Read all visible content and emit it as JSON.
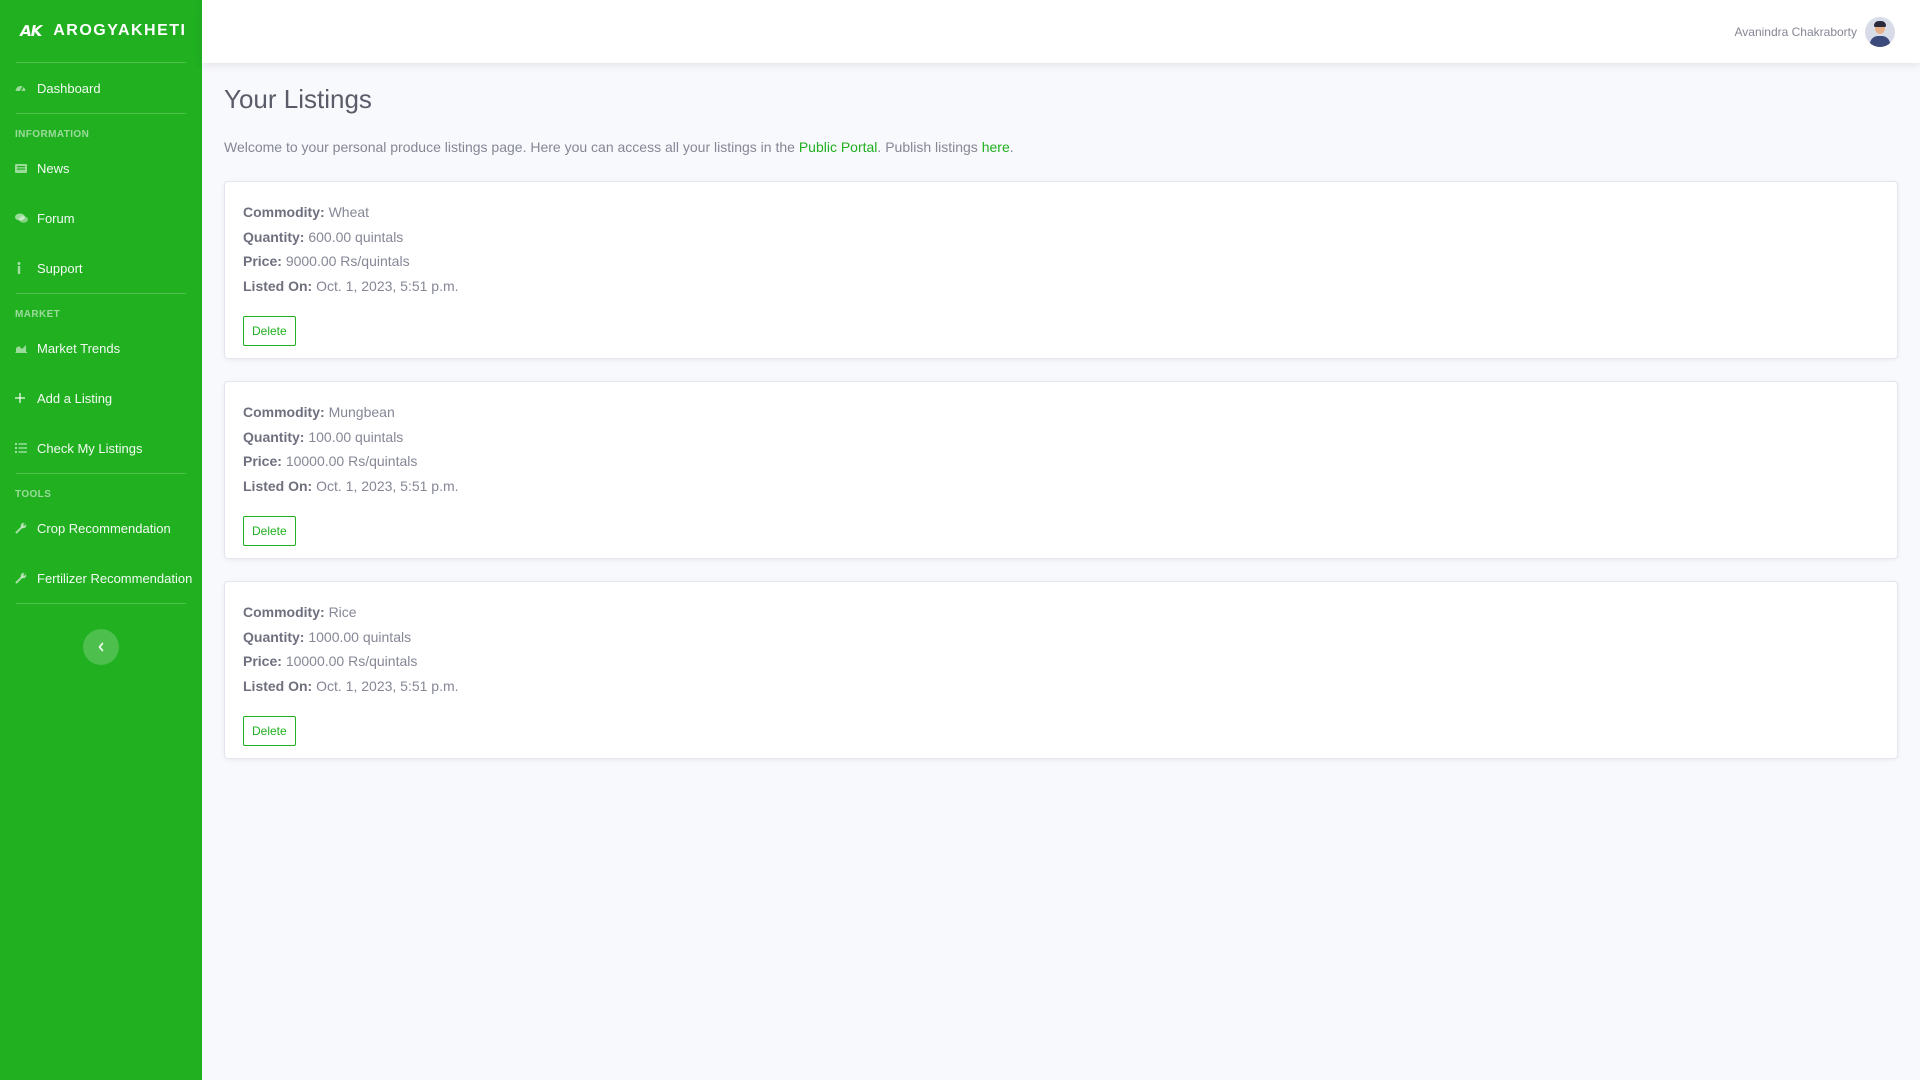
{
  "brand": {
    "logo": "AK",
    "name": "AROGYAKHETI"
  },
  "sidebar": {
    "dashboard": {
      "label": "Dashboard",
      "icon": "dashboard-icon"
    },
    "sections": [
      {
        "heading": "INFORMATION",
        "items": [
          {
            "label": "News",
            "icon": "newspaper-icon"
          },
          {
            "label": "Forum",
            "icon": "comments-icon"
          },
          {
            "label": "Support",
            "icon": "info-icon"
          }
        ]
      },
      {
        "heading": "MARKET",
        "items": [
          {
            "label": "Market Trends",
            "icon": "chart-area-icon"
          },
          {
            "label": "Add a Listing",
            "icon": "plus-icon"
          },
          {
            "label": "Check My Listings",
            "icon": "list-icon"
          }
        ]
      },
      {
        "heading": "TOOLS",
        "items": [
          {
            "label": "Crop Recommendation",
            "icon": "wrench-icon"
          },
          {
            "label": "Fertilizer Recommendation",
            "icon": "wrench-icon"
          }
        ]
      }
    ],
    "toggle_icon": "chevron-left-icon"
  },
  "topbar": {
    "user_name": "Avanindra Chakraborty"
  },
  "page": {
    "title": "Your Listings",
    "intro_before": "Welcome to your personal produce listings page. Here you can access all your listings in the ",
    "intro_link1": "Public Portal",
    "intro_middle": ". Publish listings ",
    "intro_link2": "here",
    "intro_after": "."
  },
  "labels": {
    "commodity": "Commodity:",
    "quantity": "Quantity:",
    "price": "Price:",
    "listed_on": "Listed On:",
    "delete": "Delete"
  },
  "listings": [
    {
      "commodity": "Wheat",
      "quantity": "600.00 quintals",
      "price": "9000.00 Rs/quintals",
      "listed_on": "Oct. 1, 2023, 5:51 p.m."
    },
    {
      "commodity": "Mungbean",
      "quantity": "100.00 quintals",
      "price": "10000.00 Rs/quintals",
      "listed_on": "Oct. 1, 2023, 5:51 p.m."
    },
    {
      "commodity": "Rice",
      "quantity": "1000.00 quintals",
      "price": "10000.00 Rs/quintals",
      "listed_on": "Oct. 1, 2023, 5:51 p.m."
    }
  ],
  "colors": {
    "sidebar": "#20b020",
    "accent": "#20b020",
    "background": "#f8f9fc"
  }
}
